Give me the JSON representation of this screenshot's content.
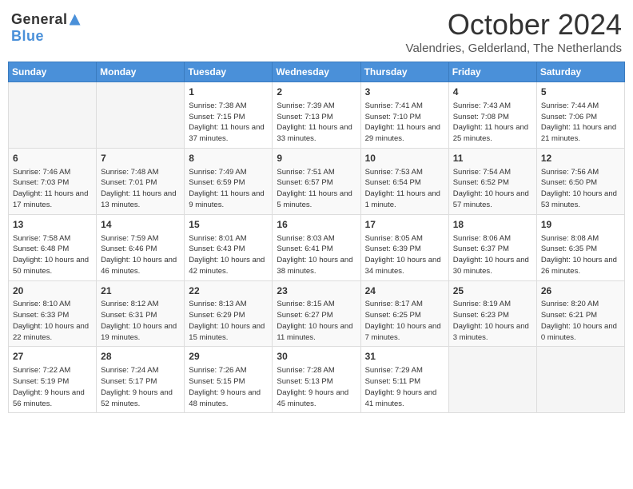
{
  "header": {
    "logo_general": "General",
    "logo_blue": "Blue",
    "title": "October 2024",
    "subtitle": "Valendries, Gelderland, The Netherlands"
  },
  "days_of_week": [
    "Sunday",
    "Monday",
    "Tuesday",
    "Wednesday",
    "Thursday",
    "Friday",
    "Saturday"
  ],
  "weeks": [
    [
      {
        "day": "",
        "info": ""
      },
      {
        "day": "",
        "info": ""
      },
      {
        "day": "1",
        "info": "Sunrise: 7:38 AM\nSunset: 7:15 PM\nDaylight: 11 hours and 37 minutes."
      },
      {
        "day": "2",
        "info": "Sunrise: 7:39 AM\nSunset: 7:13 PM\nDaylight: 11 hours and 33 minutes."
      },
      {
        "day": "3",
        "info": "Sunrise: 7:41 AM\nSunset: 7:10 PM\nDaylight: 11 hours and 29 minutes."
      },
      {
        "day": "4",
        "info": "Sunrise: 7:43 AM\nSunset: 7:08 PM\nDaylight: 11 hours and 25 minutes."
      },
      {
        "day": "5",
        "info": "Sunrise: 7:44 AM\nSunset: 7:06 PM\nDaylight: 11 hours and 21 minutes."
      }
    ],
    [
      {
        "day": "6",
        "info": "Sunrise: 7:46 AM\nSunset: 7:03 PM\nDaylight: 11 hours and 17 minutes."
      },
      {
        "day": "7",
        "info": "Sunrise: 7:48 AM\nSunset: 7:01 PM\nDaylight: 11 hours and 13 minutes."
      },
      {
        "day": "8",
        "info": "Sunrise: 7:49 AM\nSunset: 6:59 PM\nDaylight: 11 hours and 9 minutes."
      },
      {
        "day": "9",
        "info": "Sunrise: 7:51 AM\nSunset: 6:57 PM\nDaylight: 11 hours and 5 minutes."
      },
      {
        "day": "10",
        "info": "Sunrise: 7:53 AM\nSunset: 6:54 PM\nDaylight: 11 hours and 1 minute."
      },
      {
        "day": "11",
        "info": "Sunrise: 7:54 AM\nSunset: 6:52 PM\nDaylight: 10 hours and 57 minutes."
      },
      {
        "day": "12",
        "info": "Sunrise: 7:56 AM\nSunset: 6:50 PM\nDaylight: 10 hours and 53 minutes."
      }
    ],
    [
      {
        "day": "13",
        "info": "Sunrise: 7:58 AM\nSunset: 6:48 PM\nDaylight: 10 hours and 50 minutes."
      },
      {
        "day": "14",
        "info": "Sunrise: 7:59 AM\nSunset: 6:46 PM\nDaylight: 10 hours and 46 minutes."
      },
      {
        "day": "15",
        "info": "Sunrise: 8:01 AM\nSunset: 6:43 PM\nDaylight: 10 hours and 42 minutes."
      },
      {
        "day": "16",
        "info": "Sunrise: 8:03 AM\nSunset: 6:41 PM\nDaylight: 10 hours and 38 minutes."
      },
      {
        "day": "17",
        "info": "Sunrise: 8:05 AM\nSunset: 6:39 PM\nDaylight: 10 hours and 34 minutes."
      },
      {
        "day": "18",
        "info": "Sunrise: 8:06 AM\nSunset: 6:37 PM\nDaylight: 10 hours and 30 minutes."
      },
      {
        "day": "19",
        "info": "Sunrise: 8:08 AM\nSunset: 6:35 PM\nDaylight: 10 hours and 26 minutes."
      }
    ],
    [
      {
        "day": "20",
        "info": "Sunrise: 8:10 AM\nSunset: 6:33 PM\nDaylight: 10 hours and 22 minutes."
      },
      {
        "day": "21",
        "info": "Sunrise: 8:12 AM\nSunset: 6:31 PM\nDaylight: 10 hours and 19 minutes."
      },
      {
        "day": "22",
        "info": "Sunrise: 8:13 AM\nSunset: 6:29 PM\nDaylight: 10 hours and 15 minutes."
      },
      {
        "day": "23",
        "info": "Sunrise: 8:15 AM\nSunset: 6:27 PM\nDaylight: 10 hours and 11 minutes."
      },
      {
        "day": "24",
        "info": "Sunrise: 8:17 AM\nSunset: 6:25 PM\nDaylight: 10 hours and 7 minutes."
      },
      {
        "day": "25",
        "info": "Sunrise: 8:19 AM\nSunset: 6:23 PM\nDaylight: 10 hours and 3 minutes."
      },
      {
        "day": "26",
        "info": "Sunrise: 8:20 AM\nSunset: 6:21 PM\nDaylight: 10 hours and 0 minutes."
      }
    ],
    [
      {
        "day": "27",
        "info": "Sunrise: 7:22 AM\nSunset: 5:19 PM\nDaylight: 9 hours and 56 minutes."
      },
      {
        "day": "28",
        "info": "Sunrise: 7:24 AM\nSunset: 5:17 PM\nDaylight: 9 hours and 52 minutes."
      },
      {
        "day": "29",
        "info": "Sunrise: 7:26 AM\nSunset: 5:15 PM\nDaylight: 9 hours and 48 minutes."
      },
      {
        "day": "30",
        "info": "Sunrise: 7:28 AM\nSunset: 5:13 PM\nDaylight: 9 hours and 45 minutes."
      },
      {
        "day": "31",
        "info": "Sunrise: 7:29 AM\nSunset: 5:11 PM\nDaylight: 9 hours and 41 minutes."
      },
      {
        "day": "",
        "info": ""
      },
      {
        "day": "",
        "info": ""
      }
    ]
  ]
}
